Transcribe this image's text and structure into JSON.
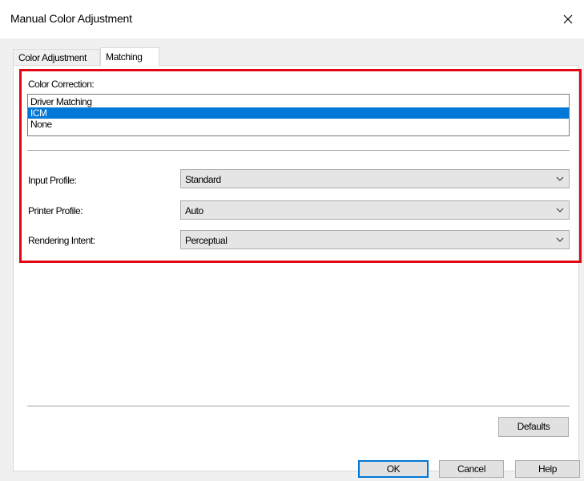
{
  "window": {
    "title": "Manual Color Adjustment",
    "close_icon": "close-icon"
  },
  "tabs": [
    {
      "label": "Color Adjustment",
      "active": false
    },
    {
      "label": "Matching",
      "active": true
    }
  ],
  "color_correction": {
    "label": "Color Correction:",
    "options": [
      "Driver Matching",
      "ICM",
      "None"
    ],
    "selected": "ICM"
  },
  "input_profile": {
    "label": "Input Profile:",
    "value": "Standard"
  },
  "printer_profile": {
    "label": "Printer Profile:",
    "value": "Auto"
  },
  "rendering_intent": {
    "label": "Rendering Intent:",
    "value": "Perceptual"
  },
  "buttons": {
    "defaults": "Defaults",
    "ok": "OK",
    "cancel": "Cancel",
    "help": "Help"
  },
  "colors": {
    "highlight_border": "#e20613",
    "selection": "#0078d7",
    "dialog_bg": "#f0f0f0"
  }
}
